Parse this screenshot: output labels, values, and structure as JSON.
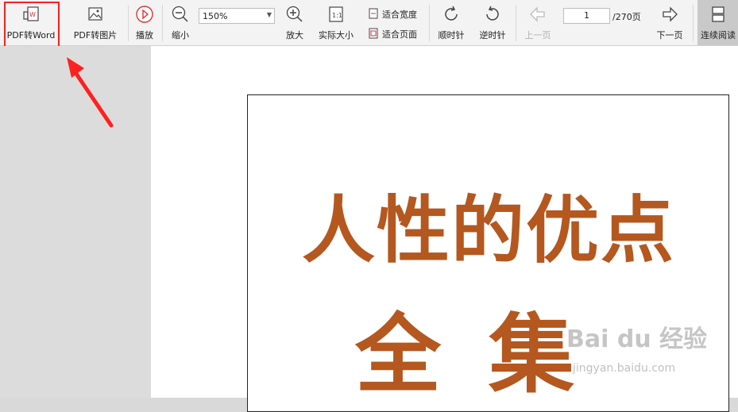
{
  "toolbar": {
    "pdf_to_word": "PDF转Word",
    "pdf_to_image": "PDF转图片",
    "play": "播放",
    "zoom_out": "缩小",
    "zoom_value": "150%",
    "zoom_in": "放大",
    "actual_size": "实际大小",
    "fit_width": "适合宽度",
    "fit_page": "适合页面",
    "rotate_cw": "顺时针",
    "rotate_ccw": "逆时针",
    "prev_page": "上一页",
    "page_current": "1",
    "page_total": "/270页",
    "next_page": "下一页",
    "continuous": "连续阅读"
  },
  "document": {
    "title_line1": "人性的优点",
    "title_line2": "全集"
  },
  "watermark": {
    "brand": "Bai du 经验",
    "url": "jingyan.baidu.com"
  },
  "colors": {
    "title": "#b4581f",
    "highlight": "#ff2020"
  }
}
